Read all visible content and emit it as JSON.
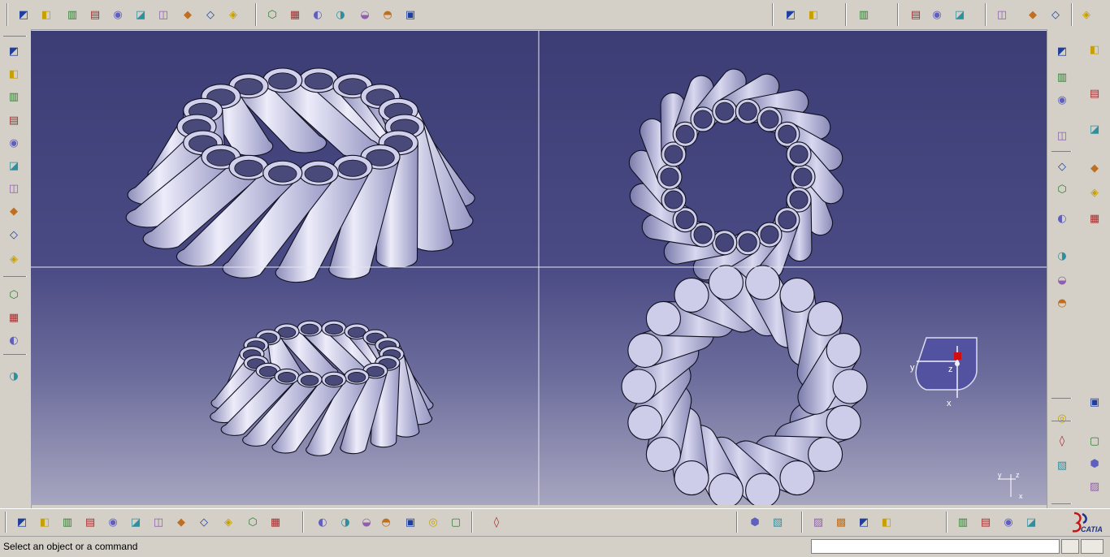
{
  "statusbar": {
    "message": "Select an object or a command",
    "command_value": ""
  },
  "compass": {
    "axis_y": "y",
    "axis_z": "z",
    "axis_x": "x"
  },
  "mini_axis": {
    "y": "y",
    "z": "z",
    "x": "x"
  },
  "brand": {
    "logo_text": "CATIA"
  },
  "colors": {
    "background_top": "#3e3e78",
    "background_bottom": "#a3a2be",
    "part_fill": "#c4c4e6",
    "part_shade": "#8686b4",
    "part_edge": "#101020",
    "viewport_divider": "#e6e6f0",
    "compass_fill": "#5252a0",
    "compass_marker": "#d01010",
    "toolbar": "#d4d0c8"
  },
  "icons": {
    "top_toolbar_left": [
      "sketch-icon",
      "positioned-sketch-icon",
      "pad-icon",
      "pocket-icon",
      "shaft-icon",
      "groove-icon",
      "hole-icon",
      "rib-icon",
      "slot-icon",
      "stiffener-icon",
      "multi-section-icon",
      "remove-multi-section-icon",
      "fillet-icon",
      "chamfer-icon",
      "draft-icon",
      "shell-icon",
      "thickness-icon",
      "thread-icon",
      "plane-icon"
    ],
    "top_toolbar_right": [
      "split-icon",
      "thick-surface-icon",
      "close-surface-icon",
      "sew-surface-icon",
      "point-icon",
      "line-icon",
      "plane-icon",
      "translate-icon",
      "mirror-icon",
      "pattern-icon",
      "compass-toggle-icon"
    ],
    "left_toolbar": [
      "new-document-icon",
      "open-icon",
      "save-icon",
      "print-icon",
      "cut-icon",
      "copy-icon",
      "paste-icon",
      "undo-icon",
      "redo-icon",
      "whats-this-icon",
      "measure-between-icon",
      "measure-item-icon",
      "measure-inertia-icon",
      "capture-icon"
    ],
    "right_toolbar": [
      "boolean-icon",
      "settings-icon",
      "assemble-icon",
      "pcs-icon",
      "add-icon",
      "select-icon",
      "remove-icon",
      "annotation-text-icon",
      "intersect-icon",
      "flag-note-icon",
      "union-trim-icon",
      "dimension-icon",
      "sketch-analysis-icon",
      "apply-material-icon",
      "scan-icon",
      "catalog-icon",
      "inertia-icon",
      "analysis-icon",
      "measure-icon",
      "body-icon",
      "surface-icon",
      "curve-icon",
      "sheet-icon"
    ],
    "bottom_toolbar": [
      "fly-mode-icon",
      "fit-all-icon",
      "pan-icon",
      "rotate-icon",
      "zoom-in-icon",
      "zoom-out-icon",
      "normal-view-icon",
      "multi-view-icon",
      "iso-view-icon",
      "shading-icon",
      "hide-show-icon",
      "swap-view-icon",
      "formula-icon",
      "knowledge-icon",
      "parameter-icon",
      "design-table-icon",
      "law-icon",
      "lock-icon",
      "reaction-icon",
      "update-icon",
      "axis-system-icon",
      "sketch-view-icon",
      "body-icon",
      "part-body-icon",
      "sketch-tools-icon",
      "material-icon",
      "catalog-browser-icon",
      "measure-icon",
      "analysis-icon",
      "publication-icon",
      "section-icon",
      "clash-icon"
    ]
  }
}
